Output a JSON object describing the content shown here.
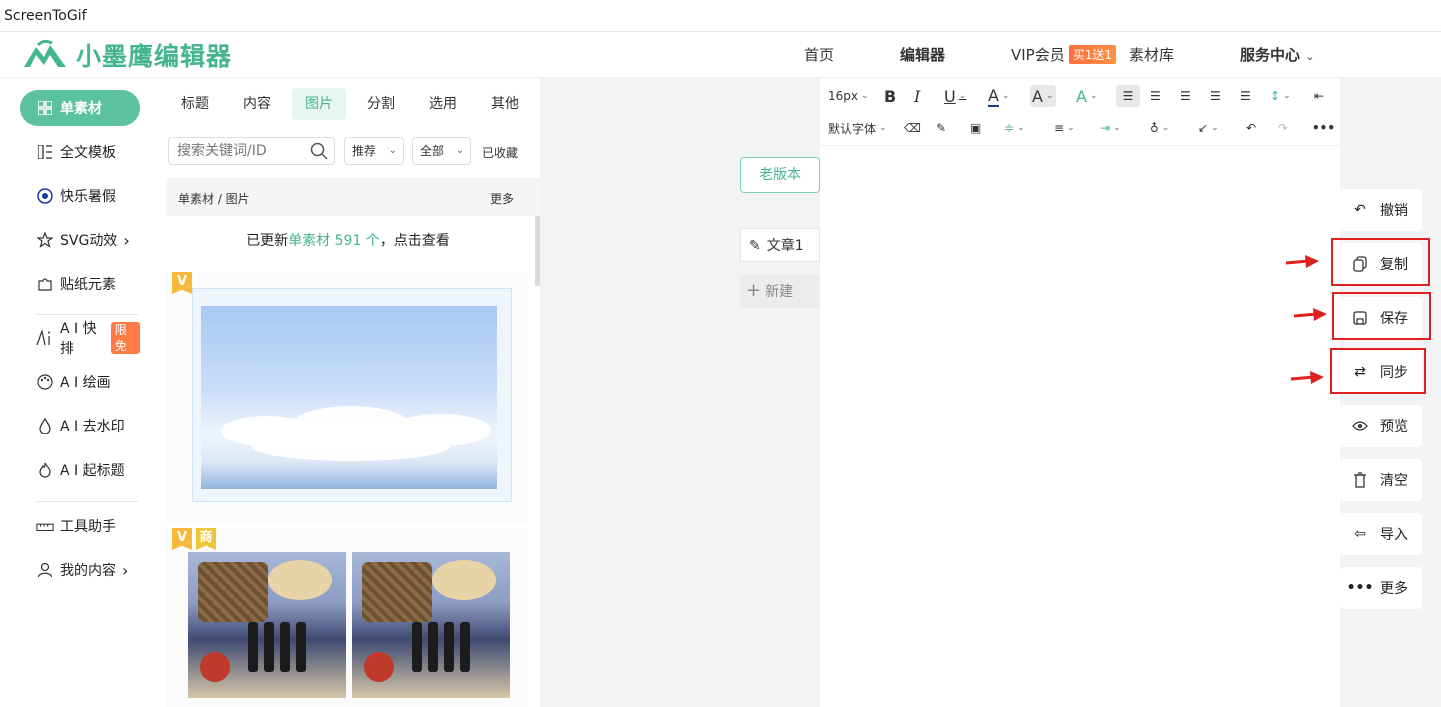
{
  "window": {
    "title": "ScreenToGif"
  },
  "brand": {
    "name": "小墨鹰编辑器",
    "color": "#43b58f"
  },
  "nav": {
    "items": [
      "首页",
      "编辑器",
      "VIP会员",
      "素材库",
      "服务中心"
    ],
    "vip_badge": "买1送1",
    "service_chevron": "⌄"
  },
  "sidebar": {
    "items": [
      {
        "label": "单素材",
        "icon": "grid-icon"
      },
      {
        "label": "全文模板",
        "icon": "template-icon"
      },
      {
        "label": "快乐暑假",
        "icon": "ball-icon"
      },
      {
        "label": "SVG动效",
        "icon": "star-icon",
        "chevron": "›"
      },
      {
        "label": "贴纸元素",
        "icon": "puzzle-icon"
      },
      {
        "label": "A I 快排",
        "icon": "ai-icon",
        "badge": "限免"
      },
      {
        "label": "A I 绘画",
        "icon": "palette-icon"
      },
      {
        "label": "A I 去水印",
        "icon": "drop-icon"
      },
      {
        "label": "A I 起标题",
        "icon": "flame-icon"
      },
      {
        "label": "工具助手",
        "icon": "ruler-icon"
      },
      {
        "label": "我的内容",
        "icon": "user-icon",
        "chevron": "›"
      }
    ]
  },
  "panel": {
    "tabs": [
      "标题",
      "内容",
      "图片",
      "分割",
      "选用",
      "其他"
    ],
    "active_tab": "图片",
    "search_placeholder": "搜索关键词/ID",
    "sort_label": "推荐",
    "filter_label": "全部",
    "favorites_label": "已收藏",
    "breadcrumb": "单素材 / 图片",
    "more_label": "更多",
    "notice_prefix": "已更新",
    "notice_highlight": "单素材 591 个",
    "notice_suffix": "，点击查看",
    "tag_v": "V",
    "tag_shang": "商"
  },
  "canvas": {
    "old_version": "老版本",
    "article": "文章1",
    "new_label": "新建"
  },
  "toolbar": {
    "font_size": "16px",
    "font_family": "默认字体"
  },
  "actions": [
    {
      "label": "撤销",
      "icon": "undo-icon"
    },
    {
      "label": "复制",
      "icon": "copy-icon"
    },
    {
      "label": "保存",
      "icon": "save-icon"
    },
    {
      "label": "同步",
      "icon": "sync-icon"
    },
    {
      "label": "预览",
      "icon": "eye-icon"
    },
    {
      "label": "清空",
      "icon": "trash-icon"
    },
    {
      "label": "导入",
      "icon": "import-icon"
    },
    {
      "label": "更多",
      "icon": "more-icon"
    }
  ],
  "highlight_color": "#e02020"
}
